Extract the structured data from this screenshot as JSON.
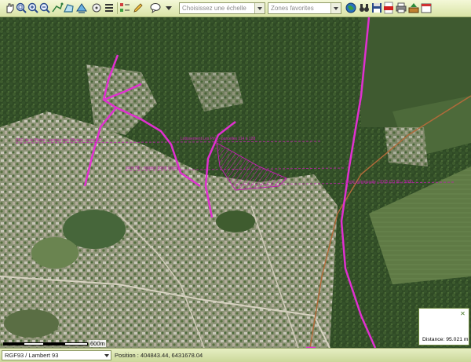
{
  "toolbar": {
    "scale_placeholder": "Choisissez une échelle",
    "zones_placeholder": "Zones favorites",
    "icons": [
      "pan-icon",
      "zoom-extent-icon",
      "zoom-in-icon",
      "zoom-out-icon",
      "measure-distance-icon",
      "measure-area-icon",
      "info-icon",
      "layers-list-icon",
      "pencil-icon",
      "comment-icon",
      "globe-icon",
      "binoculars-icon",
      "save-icon",
      "pdf-icon",
      "print-icon",
      "export-icon",
      "calendar-icon"
    ]
  },
  "map": {
    "scale_label": "600m",
    "parcel_annotations": [
      "ZAC de la Plaine - secteur des Oliviers - zone UD",
      "Lotissement Les Pins - parcelles 114 à 128",
      "zone Nb - espace boisé classé",
      "limite communale - 2015 CD 50 - 3000"
    ],
    "colors": {
      "route": "#e030d0",
      "boundary": "#b06a3a",
      "parcel_hatch": "#c020b0"
    }
  },
  "status": {
    "crs": "RGF93 / Lambert 93",
    "position": "Position : 404843.44, 6431678.04"
  },
  "distance": {
    "close_label": "✕",
    "text": "Distance: 95.021 m"
  }
}
